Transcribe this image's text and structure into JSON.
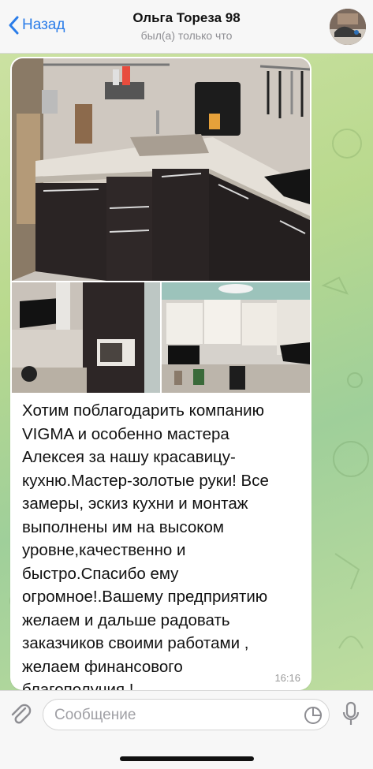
{
  "header": {
    "back_label": "Назад",
    "title": "Ольга Тореза 98",
    "status": "был(а) только что"
  },
  "message": {
    "text": "Хотим поблагодарить компанию\nVIGMA и особенно мастера\nАлексея за нашу красавицу-\nкухню.Мастер-золотые руки! Все\nзамеры, эскиз кухни и монтаж\nвыполнены им на высоком\nуровне,качественно и\nбыстро.Спасибо ему\nогромное!.Вашему предприятию\nжелаем и дальше радовать\nзаказчиков своими работами ,\nжелаем финансового\nблагополучия.!",
    "time": "16:16",
    "photos": [
      "kitchen-photo-main",
      "kitchen-photo-left",
      "kitchen-photo-right"
    ]
  },
  "composer": {
    "placeholder": "Сообщение"
  },
  "colors": {
    "accent": "#2b7de9",
    "bubble": "#ffffff",
    "cabinet": "#2a2424",
    "countertop": "#d9d3c9"
  }
}
